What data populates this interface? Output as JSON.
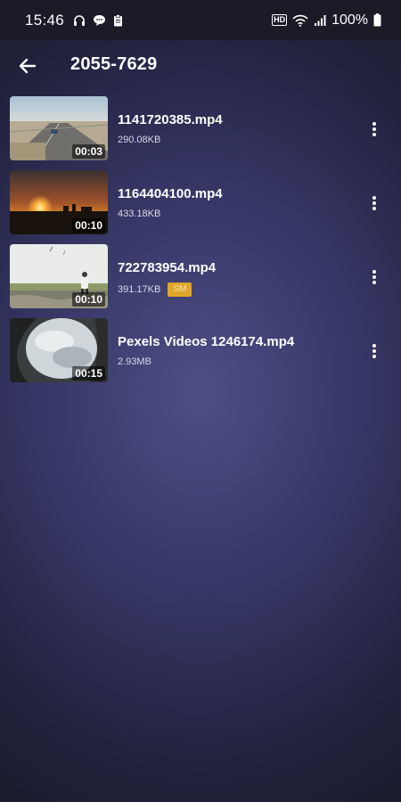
{
  "status_bar": {
    "time": "15:46",
    "left_icons": [
      "headphones-icon",
      "chat-bubble-icon",
      "clipboard-icon"
    ],
    "hd_label": "HD",
    "battery_percent": "100%"
  },
  "header": {
    "back_icon": "arrow-left-icon",
    "title": "2055-7629"
  },
  "videos": [
    {
      "name": "1141720385.mp4",
      "size": "290.08KB",
      "duration": "00:03",
      "badge": ""
    },
    {
      "name": "1164404100.mp4",
      "size": "433.18KB",
      "duration": "00:10",
      "badge": ""
    },
    {
      "name": "722783954.mp4",
      "size": "391.17KB",
      "duration": "00:10",
      "badge": "SM"
    },
    {
      "name": "Pexels Videos 1246174.mp4",
      "size": "2.93MB",
      "duration": "00:15",
      "badge": ""
    }
  ],
  "colors": {
    "badge": "#e0a62a",
    "status_bar_bg": "#1b1b27",
    "background_center": "#4d4f86"
  }
}
